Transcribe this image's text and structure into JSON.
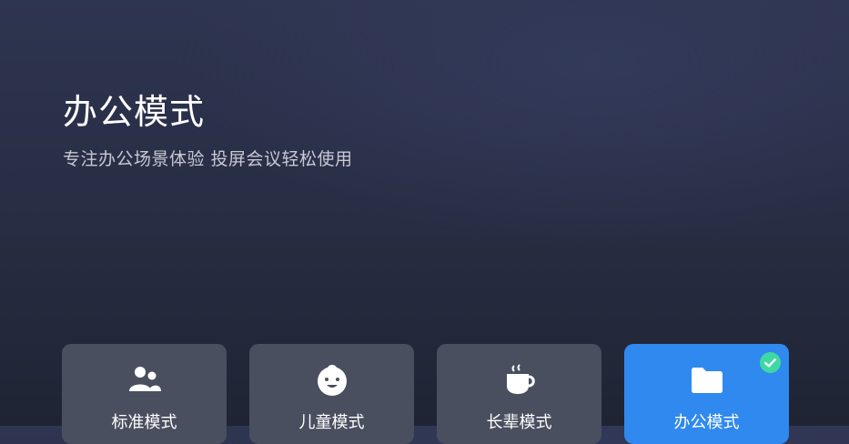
{
  "mode": {
    "title": "办公模式",
    "description": "专注办公场景体验  投屏会议轻松使用"
  },
  "mode_cards": [
    {
      "label": "标准模式",
      "icon": "users-icon",
      "selected": false
    },
    {
      "label": "儿童模式",
      "icon": "baby-face-icon",
      "selected": false
    },
    {
      "label": "长辈模式",
      "icon": "tea-cup-icon",
      "selected": false
    },
    {
      "label": "办公模式",
      "icon": "folder-icon",
      "selected": true
    }
  ],
  "colors": {
    "card_bg": "#4a4f5f",
    "card_active_bg": "#2f89ee",
    "check_badge": "#3ed9a3"
  }
}
